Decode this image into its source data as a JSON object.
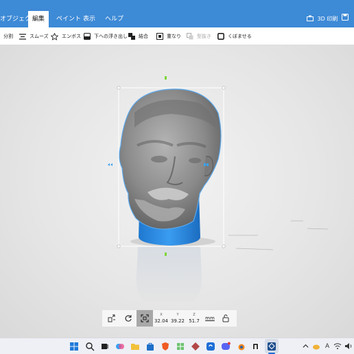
{
  "menu": {
    "tabs": [
      "オブジェクト",
      "編集",
      "ペイント",
      "表示",
      "ヘルプ"
    ],
    "active_tab": "編集",
    "print_label": "3D 印刷"
  },
  "toolbar": {
    "items": [
      {
        "label": "分割",
        "icon": "split-icon",
        "enabled": true
      },
      {
        "label": "スムーズ",
        "icon": "smooth-icon",
        "enabled": true
      },
      {
        "label": "エンボス",
        "icon": "emboss-star-icon",
        "enabled": true
      },
      {
        "label": "下への浮き出し",
        "icon": "extrude-down-icon",
        "enabled": true
      },
      {
        "label": "結合",
        "icon": "merge-icon",
        "enabled": true
      },
      {
        "label": "重なり",
        "icon": "intersect-icon",
        "enabled": true
      },
      {
        "label": "型抜き",
        "icon": "subtract-icon",
        "enabled": false
      },
      {
        "label": "くぼませる",
        "icon": "hollow-icon",
        "enabled": true
      }
    ]
  },
  "transform": {
    "x_label": "X",
    "y_label": "Y",
    "z_label": "Z",
    "x": "32.04",
    "y": "39.22",
    "z": "51.7",
    "unit": "mm"
  },
  "colors": {
    "accent": "#3d8ad6",
    "model_base": "#2f8fe6",
    "model_head": "#8a8a8a",
    "gizmo": "#7cd63a"
  },
  "taskbar": {
    "apps": [
      "windows-start-icon",
      "search-icon",
      "task-view-icon",
      "copilot-icon",
      "file-explorer-icon",
      "store-icon",
      "brave-browser-icon",
      "app-icon",
      "app-icon",
      "chrome-icon",
      "app-icon",
      "blender-icon",
      "app-icon",
      "discord-icon",
      "app-icon",
      "app-icon",
      "3d-builder-icon"
    ],
    "tray": [
      "chevron-up-icon",
      "cloud-icon",
      "A",
      "wifi-icon",
      "volume-icon"
    ]
  }
}
